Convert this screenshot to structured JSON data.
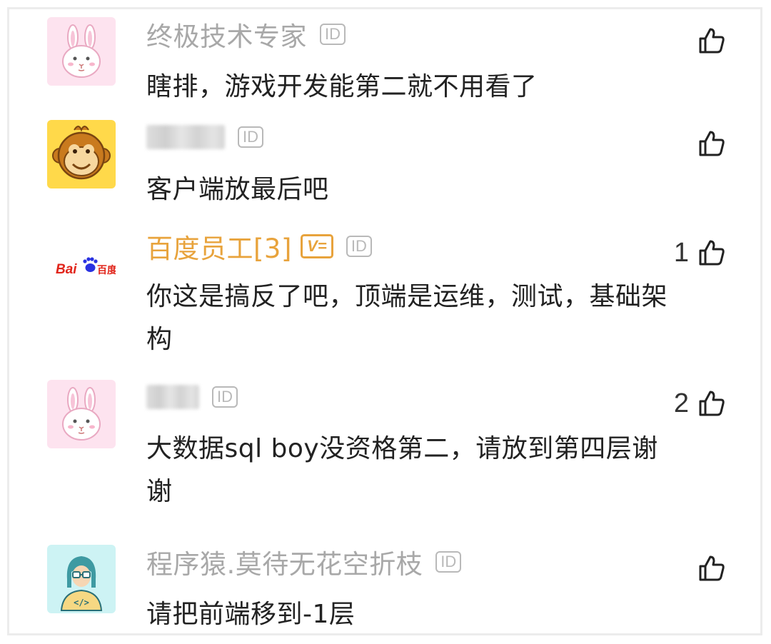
{
  "comments": [
    {
      "username": "终极技术专家",
      "id_badge": "ID",
      "text": "瞎排，游戏开发能第二就不用看了",
      "likes": "",
      "avatar": "rabbit-avatar"
    },
    {
      "username": "",
      "id_badge": "ID",
      "text": "客户端放最后吧",
      "likes": "",
      "avatar": "monkey-avatar"
    },
    {
      "username": "百度员工[3]",
      "id_badge": "ID",
      "v_badge": "V=",
      "text": "你这是搞反了吧，顶端是运维，测试，基础架构",
      "likes": "1",
      "avatar": "baidu-logo-avatar",
      "logo_text_en": "Bai",
      "logo_text_cn": "百度"
    },
    {
      "username": "",
      "id_badge": "ID",
      "text": "大数据sql boy没资格第二，请放到第四层谢谢",
      "likes": "2",
      "avatar": "rabbit-avatar"
    },
    {
      "username": "程序猿.莫待无花空折枝",
      "id_badge": "ID",
      "text": "请把前端移到-1层",
      "likes": "",
      "avatar": "programmer-avatar",
      "avatar_code_label": "</>"
    }
  ],
  "colors": {
    "username_gray": "#a8a8a8",
    "username_gold": "#e8a33c",
    "body_text": "#222222",
    "badge_gray": "#b9b9b9"
  },
  "icons": {
    "like": "thumbs-up-icon"
  }
}
